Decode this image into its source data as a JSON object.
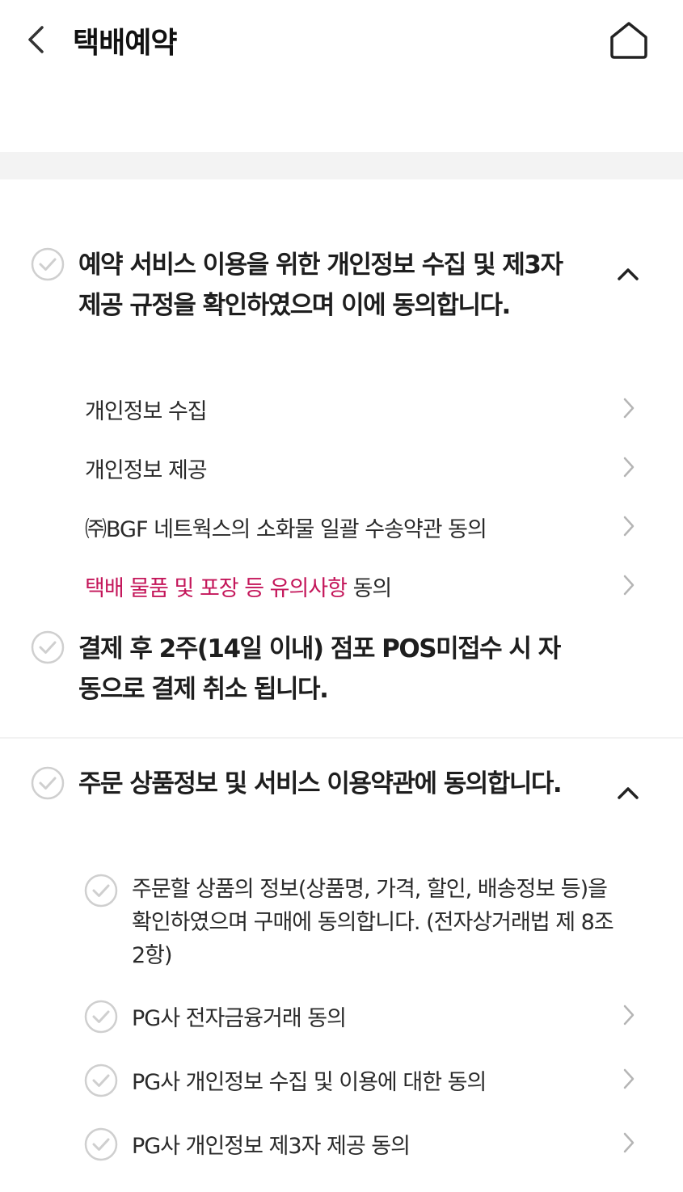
{
  "header": {
    "title": "택배예약",
    "back_icon": "chevron-left-icon",
    "home_icon": "home-icon"
  },
  "sections": [
    {
      "title": "예약 서비스 이용을 위한 개인정보 수집 및 제3자 제공 규정을 확인하였으며 이에 동의합니다.",
      "checked": false,
      "expanded": true,
      "items": [
        {
          "label": "개인정보 수집"
        },
        {
          "label": "개인정보 제공"
        },
        {
          "label": "㈜BGF 네트웍스의 소화물 일괄 수송약관 동의"
        },
        {
          "label_highlight": "택배 물품 및 포장 등 유의사항",
          "label_rest": " 동의"
        }
      ]
    },
    {
      "title": "결제 후 2주(14일 이내) 점포 POS미접수 시 자동으로 결제 취소 됩니다.",
      "checked": false
    },
    {
      "title": "주문 상품정보 및 서비스 이용약관에 동의합니다.",
      "checked": false,
      "expanded": true,
      "items": [
        {
          "label": "주문할 상품의 정보(상품명, 가격, 할인, 배송정보 등)을 확인하였으며 구매에 동의합니다. (전자상거래법 제 8조 2항)",
          "checked": false
        },
        {
          "label": "PG사 전자금융거래 동의",
          "checked": false
        },
        {
          "label": "PG사 개인정보 수집 및 이용에 대한 동의",
          "checked": false
        },
        {
          "label": "PG사 개인정보 제3자 제공 동의",
          "checked": false
        }
      ]
    }
  ],
  "colors": {
    "highlight": "#c4165a",
    "check_gray": "#cfcfcf",
    "band_gray": "#f3f3f3"
  }
}
